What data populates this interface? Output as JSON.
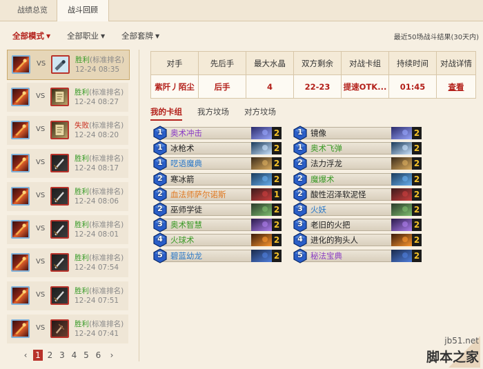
{
  "tabs": [
    {
      "label": "战绩总览",
      "active": false
    },
    {
      "label": "战斗回顾",
      "active": true
    }
  ],
  "filters": [
    {
      "label": "全部模式",
      "active": true
    },
    {
      "label": "全部职业",
      "active": false
    },
    {
      "label": "全部套牌",
      "active": false
    }
  ],
  "recent_summary": "最近50场战斗结果(30天内)",
  "vs_label": "VS",
  "matches": [
    {
      "result": "胜利",
      "result_type": "win",
      "mode": "(标准排名)",
      "time": "12-24 08:35",
      "my_hero_icon": "mage-fireball-icon",
      "opp_hero_icon": "mage-frost-icon",
      "selected": true
    },
    {
      "result": "胜利",
      "result_type": "win",
      "mode": "(标准排名)",
      "time": "12-24 08:27",
      "my_hero_icon": "mage-fireball-icon",
      "opp_hero_icon": "spellbook-icon",
      "selected": false
    },
    {
      "result": "失败",
      "result_type": "loss",
      "mode": "(标准排名)",
      "time": "12-24 08:20",
      "my_hero_icon": "mage-fireball-icon",
      "opp_hero_icon": "spellbook-icon",
      "selected": false
    },
    {
      "result": "胜利",
      "result_type": "win",
      "mode": "(标准排名)",
      "time": "12-24 08:17",
      "my_hero_icon": "mage-fireball-icon",
      "opp_hero_icon": "sword-icon",
      "selected": false
    },
    {
      "result": "胜利",
      "result_type": "win",
      "mode": "(标准排名)",
      "time": "12-24 08:06",
      "my_hero_icon": "mage-fireball-icon",
      "opp_hero_icon": "sword-icon",
      "selected": false
    },
    {
      "result": "胜利",
      "result_type": "win",
      "mode": "(标准排名)",
      "time": "12-24 08:01",
      "my_hero_icon": "mage-fireball-icon",
      "opp_hero_icon": "sword-icon",
      "selected": false
    },
    {
      "result": "胜利",
      "result_type": "win",
      "mode": "(标准排名)",
      "time": "12-24 07:54",
      "my_hero_icon": "mage-fireball-icon",
      "opp_hero_icon": "sword-icon",
      "selected": false
    },
    {
      "result": "胜利",
      "result_type": "win",
      "mode": "(标准排名)",
      "time": "12-24 07:51",
      "my_hero_icon": "mage-fireball-icon",
      "opp_hero_icon": "sword-icon",
      "selected": false
    },
    {
      "result": "胜利",
      "result_type": "win",
      "mode": "(标准排名)",
      "time": "12-24 07:41",
      "my_hero_icon": "mage-fireball-icon",
      "opp_hero_icon": "dagger-icon",
      "selected": false
    }
  ],
  "pagination": {
    "prev": "‹",
    "next": "›",
    "pages": [
      "1",
      "2",
      "3",
      "4",
      "5",
      "6"
    ],
    "current": "1"
  },
  "match_info": {
    "headers": [
      "对手",
      "先后手",
      "最大水晶",
      "双方剩余",
      "对战卡组",
      "持续时间",
      "对战详情"
    ],
    "values": [
      "紫阡丿陌尘",
      "后手",
      "4",
      "22-23",
      "提速OTK...",
      "01:45",
      "查看"
    ]
  },
  "subtabs": [
    "我的卡组",
    "我方坟场",
    "对方坟场"
  ],
  "cards_left": [
    {
      "cost": "1",
      "name": "奥术冲击",
      "rarity": "epic",
      "count": "2"
    },
    {
      "cost": "1",
      "name": "冰枪术",
      "rarity": "common",
      "count": "2"
    },
    {
      "cost": "1",
      "name": "呓语魔典",
      "rarity": "rare",
      "count": "2"
    },
    {
      "cost": "2",
      "name": "寒冰箭",
      "rarity": "common",
      "count": "2"
    },
    {
      "cost": "2",
      "name": "血法师萨尔诺斯",
      "rarity": "legend",
      "count": "1"
    },
    {
      "cost": "2",
      "name": "巫师学徒",
      "rarity": "common",
      "count": "2"
    },
    {
      "cost": "3",
      "name": "奥术智慧",
      "rarity": "free",
      "count": "2"
    },
    {
      "cost": "4",
      "name": "火球术",
      "rarity": "free",
      "count": "2"
    },
    {
      "cost": "5",
      "name": "碧蓝幼龙",
      "rarity": "rare",
      "count": "2"
    }
  ],
  "cards_right": [
    {
      "cost": "1",
      "name": "镜像",
      "rarity": "common",
      "count": "2"
    },
    {
      "cost": "1",
      "name": "奥术飞弹",
      "rarity": "free",
      "count": "2"
    },
    {
      "cost": "2",
      "name": "法力浮龙",
      "rarity": "common",
      "count": "2"
    },
    {
      "cost": "2",
      "name": "魔爆术",
      "rarity": "free",
      "count": "2"
    },
    {
      "cost": "2",
      "name": "酸性沼泽软泥怪",
      "rarity": "common",
      "count": "2"
    },
    {
      "cost": "3",
      "name": "火妖",
      "rarity": "rare",
      "count": "2"
    },
    {
      "cost": "3",
      "name": "老旧的火把",
      "rarity": "common",
      "count": "2"
    },
    {
      "cost": "4",
      "name": "进化的狗头人",
      "rarity": "common",
      "count": "2"
    },
    {
      "cost": "5",
      "name": "秘法宝典",
      "rarity": "epic",
      "count": "2"
    }
  ],
  "watermark": {
    "site": "jb51.net",
    "name": "脚本之家"
  },
  "colors": {
    "accent": "#b3201a",
    "win": "#3a9c2a",
    "loss": "#c82a1c",
    "card_count": "#f5c22a",
    "mana_gem": "#2a5ec8"
  }
}
